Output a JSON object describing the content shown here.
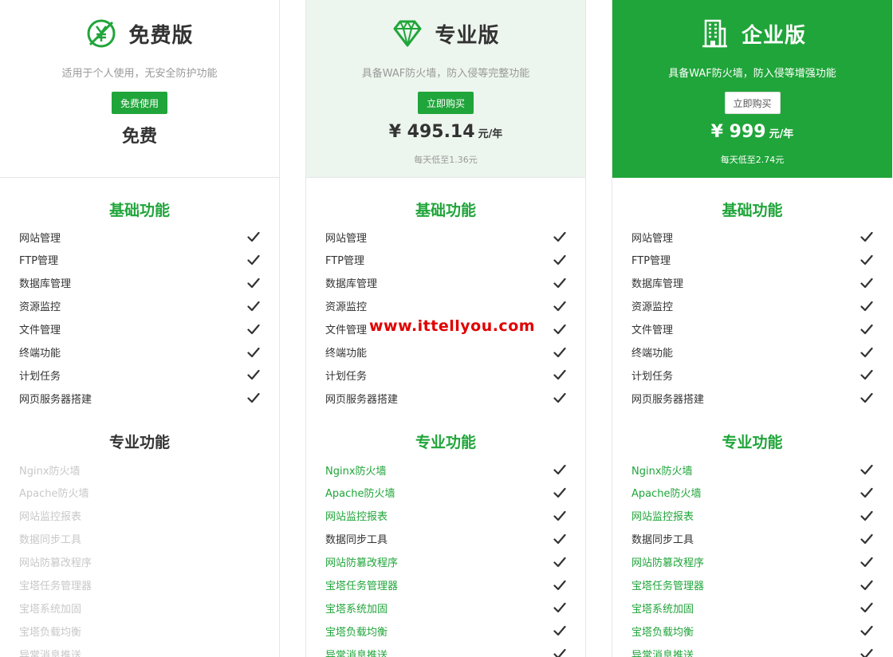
{
  "plans": {
    "free": {
      "title": "免费版",
      "icon": "no-yuan-icon",
      "desc": "适用于个人使用，无安全防护功能",
      "button": "免费使用",
      "price_label": "免费"
    },
    "pro": {
      "title": "专业版",
      "icon": "diamond-icon",
      "desc": "具备WAF防火墙，防入侵等完整功能",
      "button": "立即购买",
      "price": "¥ 495.14",
      "unit": "元/年",
      "daily": "每天低至1.36元"
    },
    "ent": {
      "title": "企业版",
      "icon": "building-icon",
      "desc": "具备WAF防火墙，防入侵等增强功能",
      "button": "立即购买",
      "price": "¥ 999",
      "unit": "元/年",
      "daily": "每天低至2.74元"
    }
  },
  "sections": {
    "basic": "基础功能",
    "pro": "专业功能"
  },
  "basic_features": [
    "网站管理",
    "FTP管理",
    "数据库管理",
    "资源监控",
    "文件管理",
    "终端功能",
    "计划任务",
    "网页服务器搭建"
  ],
  "pro_features": [
    "Nginx防火墙",
    "Apache防火墙",
    "网站监控报表",
    "数据同步工具",
    "网站防篡改程序",
    "宝塔任务管理器",
    "宝塔系统加固",
    "宝塔负载均衡",
    "异常消息推送"
  ],
  "watermark": "www.ittellyou.com",
  "colors": {
    "accent": "#20a53a",
    "pro_header_bg": "#edf6ee",
    "disabled_text": "#c8c8c8",
    "watermark": "#e00000"
  }
}
